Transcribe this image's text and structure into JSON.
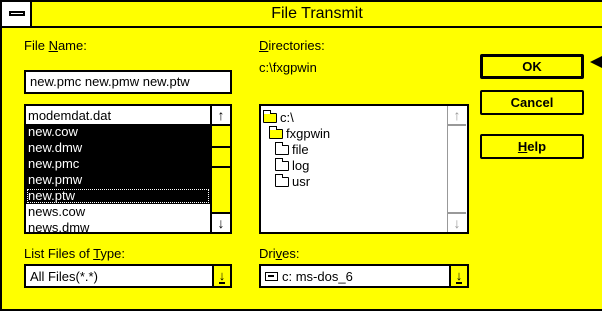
{
  "window": {
    "title": "File Transmit"
  },
  "file_name": {
    "label_pre": "File ",
    "label_ul": "N",
    "label_post": "ame:",
    "value": "new.pmc new.pmw new.ptw"
  },
  "file_list": {
    "items": [
      {
        "name": "modemdat.dat",
        "selected": false
      },
      {
        "name": "new.cow",
        "selected": true
      },
      {
        "name": "new.dmw",
        "selected": true
      },
      {
        "name": "new.pmc",
        "selected": true
      },
      {
        "name": "new.pmw",
        "selected": true
      },
      {
        "name": "new.ptw",
        "selected": true
      },
      {
        "name": "news.cow",
        "selected": false
      },
      {
        "name": "news.dmw",
        "selected": false
      }
    ]
  },
  "directories": {
    "label_ul": "D",
    "label_post": "irectories:",
    "current_path": "c:\\fxgpwin",
    "items": [
      {
        "name": "c:\\",
        "icon": "open-folder-icon"
      },
      {
        "name": "fxgpwin",
        "icon": "open-folder-icon"
      },
      {
        "name": "file",
        "icon": "folder-icon"
      },
      {
        "name": "log",
        "icon": "folder-icon"
      },
      {
        "name": "usr",
        "icon": "folder-icon"
      }
    ]
  },
  "file_type": {
    "label_pre": "List Files of ",
    "label_ul": "T",
    "label_post": "ype:",
    "value": "All Files(*.*)"
  },
  "drives": {
    "label_pre": "Dri",
    "label_ul": "v",
    "label_post": "es:",
    "value": "c: ms-dos_6"
  },
  "buttons": {
    "ok": "OK",
    "cancel": "Cancel",
    "help_ul": "H",
    "help_post": "elp"
  },
  "colors": {
    "accent": "#ffff00",
    "selection": "#000000"
  }
}
